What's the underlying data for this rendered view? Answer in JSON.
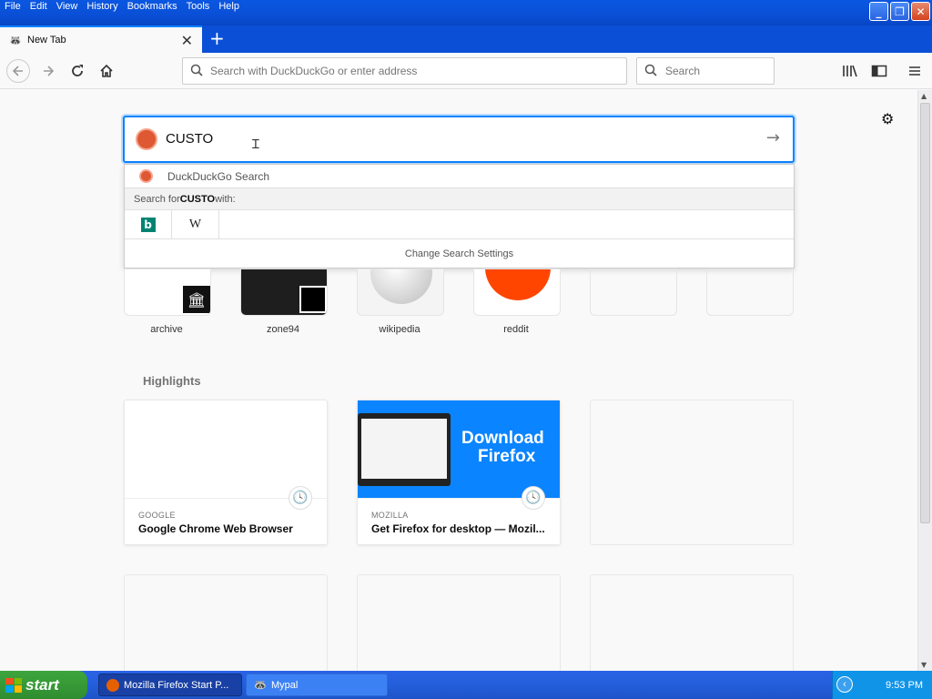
{
  "menubar": {
    "items": [
      "File",
      "Edit",
      "View",
      "History",
      "Bookmarks",
      "Tools",
      "Help"
    ]
  },
  "tab": {
    "title": "New Tab"
  },
  "urlbar": {
    "placeholder": "Search with DuckDuckGo or enter address"
  },
  "searchbar": {
    "placeholder": "Search"
  },
  "search": {
    "query": "CUSTO"
  },
  "dropdown": {
    "engine_label": "DuckDuckGo Search",
    "search_for_prefix": "Search for ",
    "search_for_term": "CUSTO",
    "search_for_suffix": " with:",
    "bing_label": "b",
    "wiki_label": "W",
    "settings_label": "Change Search Settings"
  },
  "topsites": [
    {
      "label": "archive"
    },
    {
      "label": "zone94"
    },
    {
      "label": "wikipedia"
    },
    {
      "label": "reddit"
    }
  ],
  "highlights": {
    "title": "Highlights",
    "cards": [
      {
        "host": "GOOGLE",
        "title": "Google Chrome Web Browser"
      },
      {
        "host": "MOZILLA",
        "title": "Get Firefox for desktop — Mozil...",
        "thumb_line1": "Download",
        "thumb_line2": "Firefox"
      }
    ]
  },
  "taskbar": {
    "start_label": "start",
    "items": [
      "Mozilla Firefox Start P...",
      "Mypal"
    ],
    "clock": "9:53 PM"
  },
  "colors": {
    "accent": "#0a84ff",
    "ddg": "#de5833",
    "xp_blue": "#245edb",
    "xp_green": "#3ea53e",
    "mozilla_blue": "#0a84ff"
  }
}
